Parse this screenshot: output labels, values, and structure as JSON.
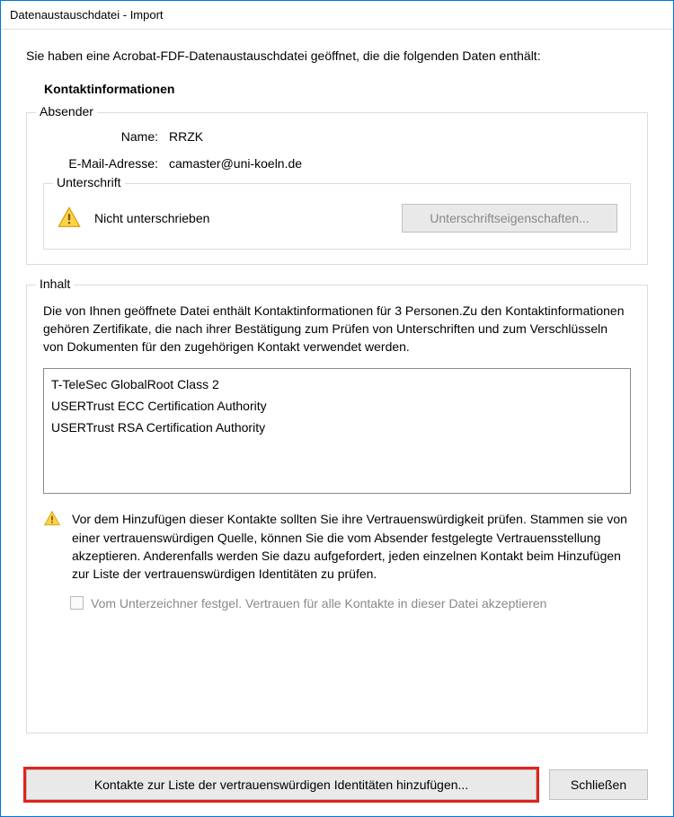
{
  "window": {
    "title": "Datenaustauschdatei - Import"
  },
  "intro": "Sie haben eine Acrobat-FDF-Datenaustauschdatei geöffnet, die die folgenden Daten enthält:",
  "subhead": "Kontaktinformationen",
  "sender": {
    "legend": "Absender",
    "name_label": "Name:",
    "name_value": "RRZK",
    "email_label": "E-Mail-Adresse:",
    "email_value": "camaster@uni-koeln.de",
    "signature": {
      "legend": "Unterschrift",
      "status": "Nicht unterschrieben",
      "props_button": "Unterschriftseigenschaften..."
    }
  },
  "contents": {
    "legend": "Inhalt",
    "description": "Die von Ihnen geöffnete Datei enthält Kontaktinformationen für 3 Personen.Zu den Kontaktinformationen gehören Zertifikate, die nach ihrer Bestätigung zum Prüfen von Unterschriften und zum Verschlüsseln von Dokumenten für den zugehörigen Kontakt verwendet werden.",
    "certificates": [
      "T-TeleSec GlobalRoot Class 2",
      "USERTrust ECC Certification Authority",
      "USERTrust RSA Certification Authority"
    ],
    "trust_warning": "Vor dem Hinzufügen dieser Kontakte sollten Sie ihre Vertrauenswürdigkeit prüfen. Stammen sie von einer vertrauenswürdigen Quelle, können Sie die vom Absender festgelegte Vertrauensstellung akzeptieren. Anderenfalls werden Sie dazu aufgefordert, jeden einzelnen Kontakt beim Hinzufügen zur Liste der vertrauenswürdigen Identitäten zu prüfen.",
    "accept_checkbox_label": "Vom Unterzeichner festgel. Vertrauen für alle Kontakte in dieser Datei akzeptieren"
  },
  "footer": {
    "add_button": "Kontakte zur Liste der vertrauenswürdigen Identitäten hinzufügen...",
    "close_button": "Schließen"
  }
}
